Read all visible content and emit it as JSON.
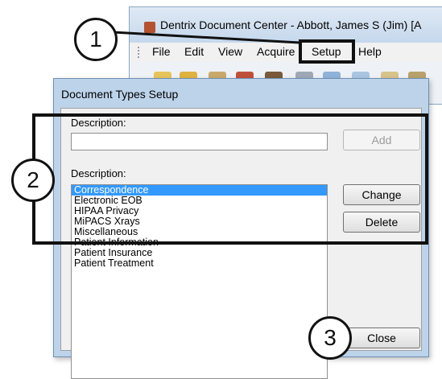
{
  "background_window": {
    "title": "Dentrix Document Center - Abbott, James S (Jim) [A",
    "menu": [
      "File",
      "Edit",
      "View",
      "Acquire",
      "Setup",
      "Help"
    ]
  },
  "dialog": {
    "title": "Document Types Setup",
    "description_label_1": "Description:",
    "description_value": "",
    "description_label_2": "Description:",
    "buttons": {
      "add": "Add",
      "change": "Change",
      "delete": "Delete",
      "close": "Close"
    },
    "items": [
      "Correspondence",
      "Electronic EOB",
      "HIPAA Privacy",
      "MiPACS Xrays",
      "Miscellaneous",
      "Patient Information",
      "Patient Insurance",
      "Patient Treatment"
    ],
    "selected_item": "Correspondence"
  },
  "callouts": [
    "1",
    "2",
    "3"
  ]
}
